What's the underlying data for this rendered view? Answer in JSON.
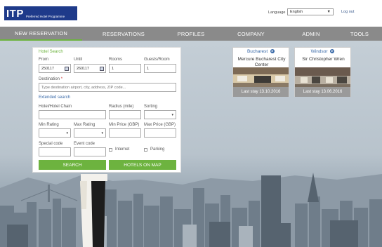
{
  "header": {
    "logo_main": "ITP",
    "logo_sub": "Preferred Hotel Programme",
    "language_label": "Language",
    "language_value": "English",
    "logout": "Log out"
  },
  "nav": [
    {
      "label": "NEW RESERVATION",
      "active": true
    },
    {
      "label": "RESERVATIONS",
      "active": false
    },
    {
      "label": "PROFILES",
      "active": false
    },
    {
      "label": "COMPANY",
      "active": false
    },
    {
      "label": "ADMIN",
      "active": false
    },
    {
      "label": "TOOLS",
      "active": false
    }
  ],
  "search": {
    "title": "Hotel Search",
    "from_label": "From",
    "from_value": "250117",
    "until_label": "Until",
    "until_value": "260117",
    "rooms_label": "Rooms",
    "rooms_value": "1",
    "guests_label": "Guests/Room",
    "guests_value": "1",
    "destination_label": "Destination",
    "destination_required": "*",
    "destination_placeholder": "Type destination airport, city, address, ZIP code...",
    "extended_search": "Extended search",
    "chain_label": "Hotel/Hotel Chain",
    "radius_label": "Radius (mile)",
    "sorting_label": "Sorting",
    "min_rating_label": "Min Rating",
    "max_rating_label": "Max Rating",
    "min_price_label": "Min Price (GBP)",
    "max_price_label": "Max Price (GBP)",
    "special_code_label": "Special code",
    "event_code_label": "Event code",
    "internet_label": "Internet",
    "parking_label": "Parking",
    "search_button": "SEARCH",
    "map_button": "HOTELS ON MAP"
  },
  "recent_hotels": [
    {
      "city": "Bucharest",
      "name": "Mercure Bucharest City Center",
      "last_stay": "Last stay 13.10.2016"
    },
    {
      "city": "Windsor",
      "name": "Sir Christopher Wren",
      "last_stay": "Last stay 13.06.2016"
    }
  ],
  "colors": {
    "brand_blue": "#1e3a8a",
    "accent_green": "#6db33f",
    "nav_gray": "#8a8a8a",
    "link_blue": "#3a6aa8"
  }
}
